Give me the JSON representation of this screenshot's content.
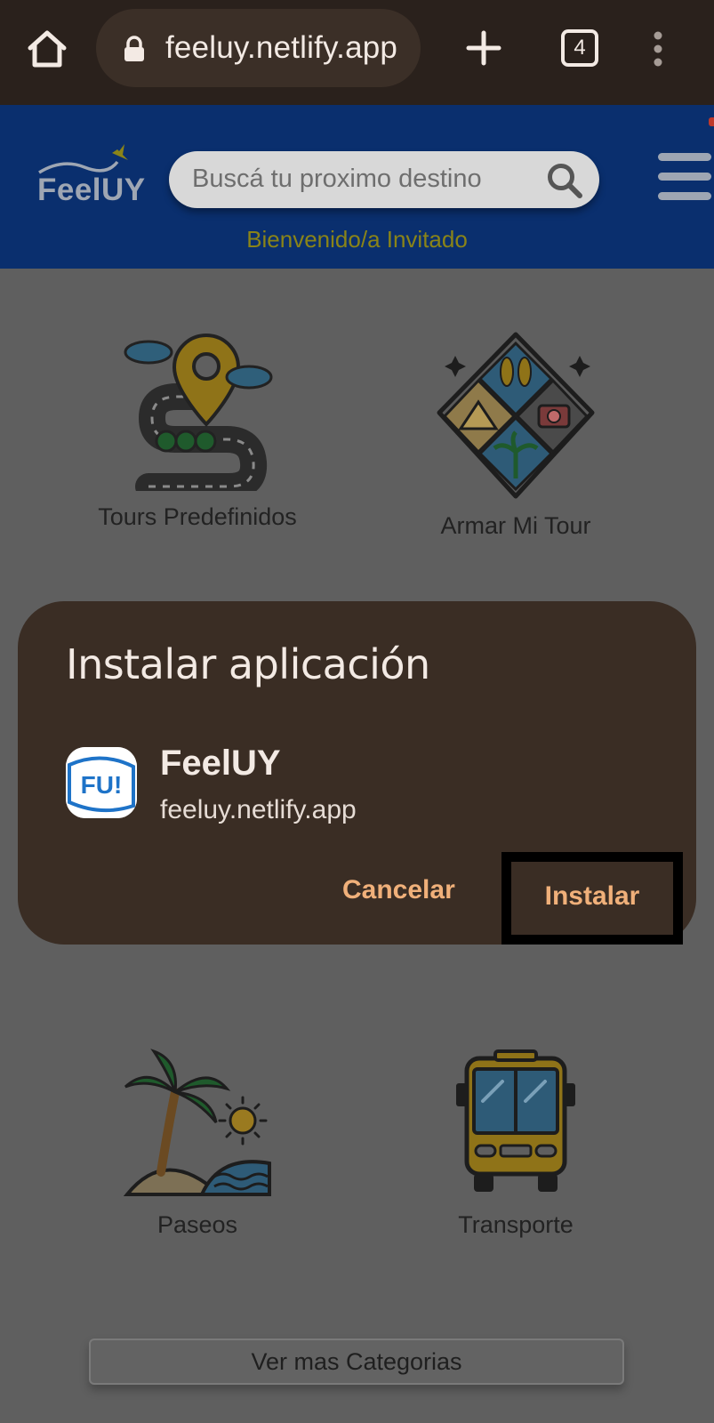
{
  "browser": {
    "url": "feeluy.netlify.app",
    "tab_count": "4"
  },
  "header": {
    "logo_text": "FeelUY",
    "search_placeholder": "Buscá tu proximo destino",
    "welcome": "Bienvenido/a Invitado"
  },
  "categories": [
    {
      "label": "Tours Predefinidos",
      "icon": "map-route-icon"
    },
    {
      "label": "Armar Mi Tour",
      "icon": "travel-collage-icon"
    },
    {
      "label": "Paseos",
      "icon": "palm-island-icon"
    },
    {
      "label": "Transporte",
      "icon": "bus-icon"
    }
  ],
  "dialog": {
    "title": "Instalar aplicación",
    "app_name": "FeelUY",
    "app_url": "feeluy.netlify.app",
    "app_icon_text": "FU!",
    "cancel_label": "Cancelar",
    "install_label": "Instalar"
  },
  "more_button": "Ver mas Categorias",
  "colors": {
    "header_bg": "#0a2f6e",
    "dialog_bg": "#3a2d24",
    "accent": "#f0b07a",
    "welcome_text": "#8a8418"
  }
}
